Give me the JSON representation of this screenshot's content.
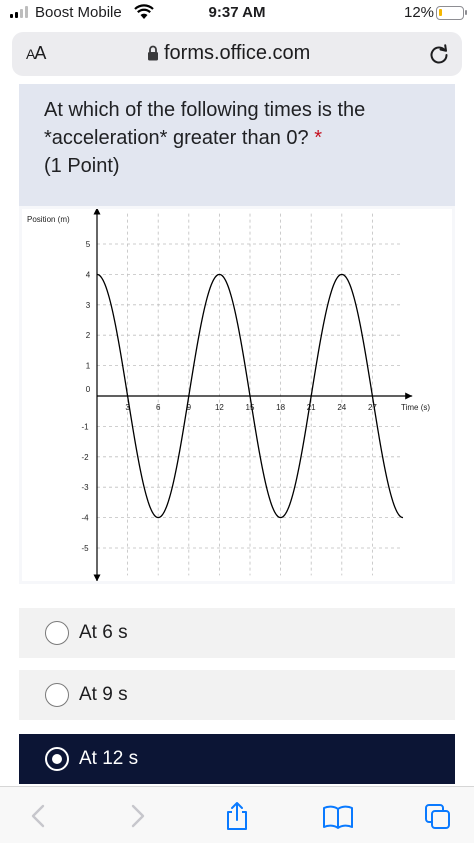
{
  "status_bar": {
    "carrier": "Boost Mobile",
    "time": "9:37 AM",
    "battery": "12%",
    "battery_level": 0.12
  },
  "address_bar": {
    "text_size_label_small": "A",
    "text_size_label_large": "A",
    "url": "forms.office.com"
  },
  "question": {
    "line1": "At which of the following times is the",
    "line2": "*acceleration* greater than 0?",
    "required_mark": "*",
    "points": "(1 Point)"
  },
  "chart_data": {
    "type": "line",
    "ylabel": "Position (m)",
    "xlabel": "Time (s)",
    "x_ticks": [
      "3",
      "6",
      "9",
      "12",
      "15",
      "18",
      "21",
      "24",
      "27"
    ],
    "y_ticks": [
      "5",
      "4",
      "3",
      "2",
      "1",
      "0",
      "-1",
      "-2",
      "-3",
      "-4",
      "-5"
    ],
    "xlim": [
      0,
      30
    ],
    "ylim": [
      -6,
      6
    ],
    "grid": true,
    "series": [
      {
        "x": [
          0,
          1.5,
          3,
          4.5,
          6,
          7.5,
          9,
          10.5,
          12,
          13.5,
          15,
          16.5,
          18,
          19.5,
          21,
          22.5,
          24,
          25.5,
          27,
          28.5,
          30
        ],
        "values": [
          4,
          2.83,
          0,
          -2.83,
          -4,
          -2.83,
          0,
          2.83,
          4,
          2.83,
          0,
          -2.83,
          -4,
          -2.83,
          0,
          2.83,
          4,
          2.83,
          0,
          -2.83,
          -4
        ]
      }
    ]
  },
  "options": [
    {
      "label": "At 6 s",
      "selected": false
    },
    {
      "label": "At 9 s",
      "selected": false
    },
    {
      "label": "At 12 s",
      "selected": true
    }
  ],
  "toolbar": {
    "icons": [
      "back-icon",
      "forward-icon",
      "share-icon",
      "bookmarks-icon",
      "tabs-icon"
    ]
  }
}
